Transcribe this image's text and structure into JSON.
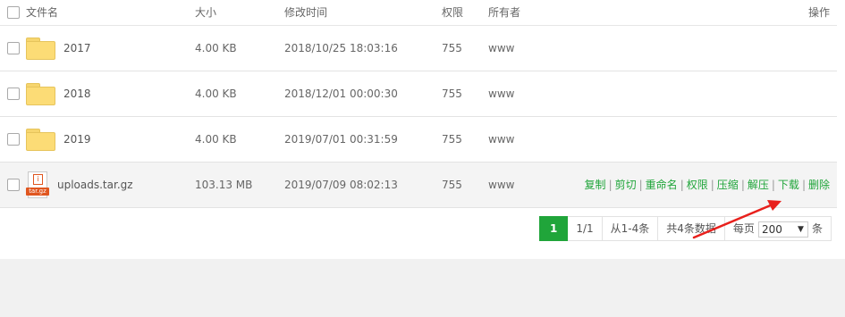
{
  "columns": {
    "name": "文件名",
    "size": "大小",
    "mtime": "修改时间",
    "perm": "权限",
    "owner": "所有者",
    "ops": "操作"
  },
  "rows": [
    {
      "name": "2017",
      "size": "4.00 KB",
      "mtime": "2018/10/25 18:03:16",
      "perm": "755",
      "owner": "www",
      "icon": "folder-icon"
    },
    {
      "name": "2018",
      "size": "4.00 KB",
      "mtime": "2018/12/01 00:00:30",
      "perm": "755",
      "owner": "www",
      "icon": "folder-icon"
    },
    {
      "name": "2019",
      "size": "4.00 KB",
      "mtime": "2019/07/01 00:31:59",
      "perm": "755",
      "owner": "www",
      "icon": "folder-icon"
    },
    {
      "name": "uploads.tar.gz",
      "size": "103.13 MB",
      "mtime": "2019/07/09 08:02:13",
      "perm": "755",
      "owner": "www",
      "icon": "archive-file-icon",
      "icon_ext": "tar.gz",
      "icon_glyph": "i",
      "actions": [
        "复制",
        "剪切",
        "重命名",
        "权限",
        "压缩",
        "解压",
        "下载",
        "删除"
      ]
    }
  ],
  "pagination": {
    "current": "1",
    "pages": "1/1",
    "range": "从1-4条",
    "total": "共4条数据",
    "per_page_prefix": "每页",
    "per_page_value": "200",
    "per_page_suffix": "条"
  },
  "colors": {
    "accent": "#20a53a",
    "annotation_arrow": "#e8201c"
  }
}
